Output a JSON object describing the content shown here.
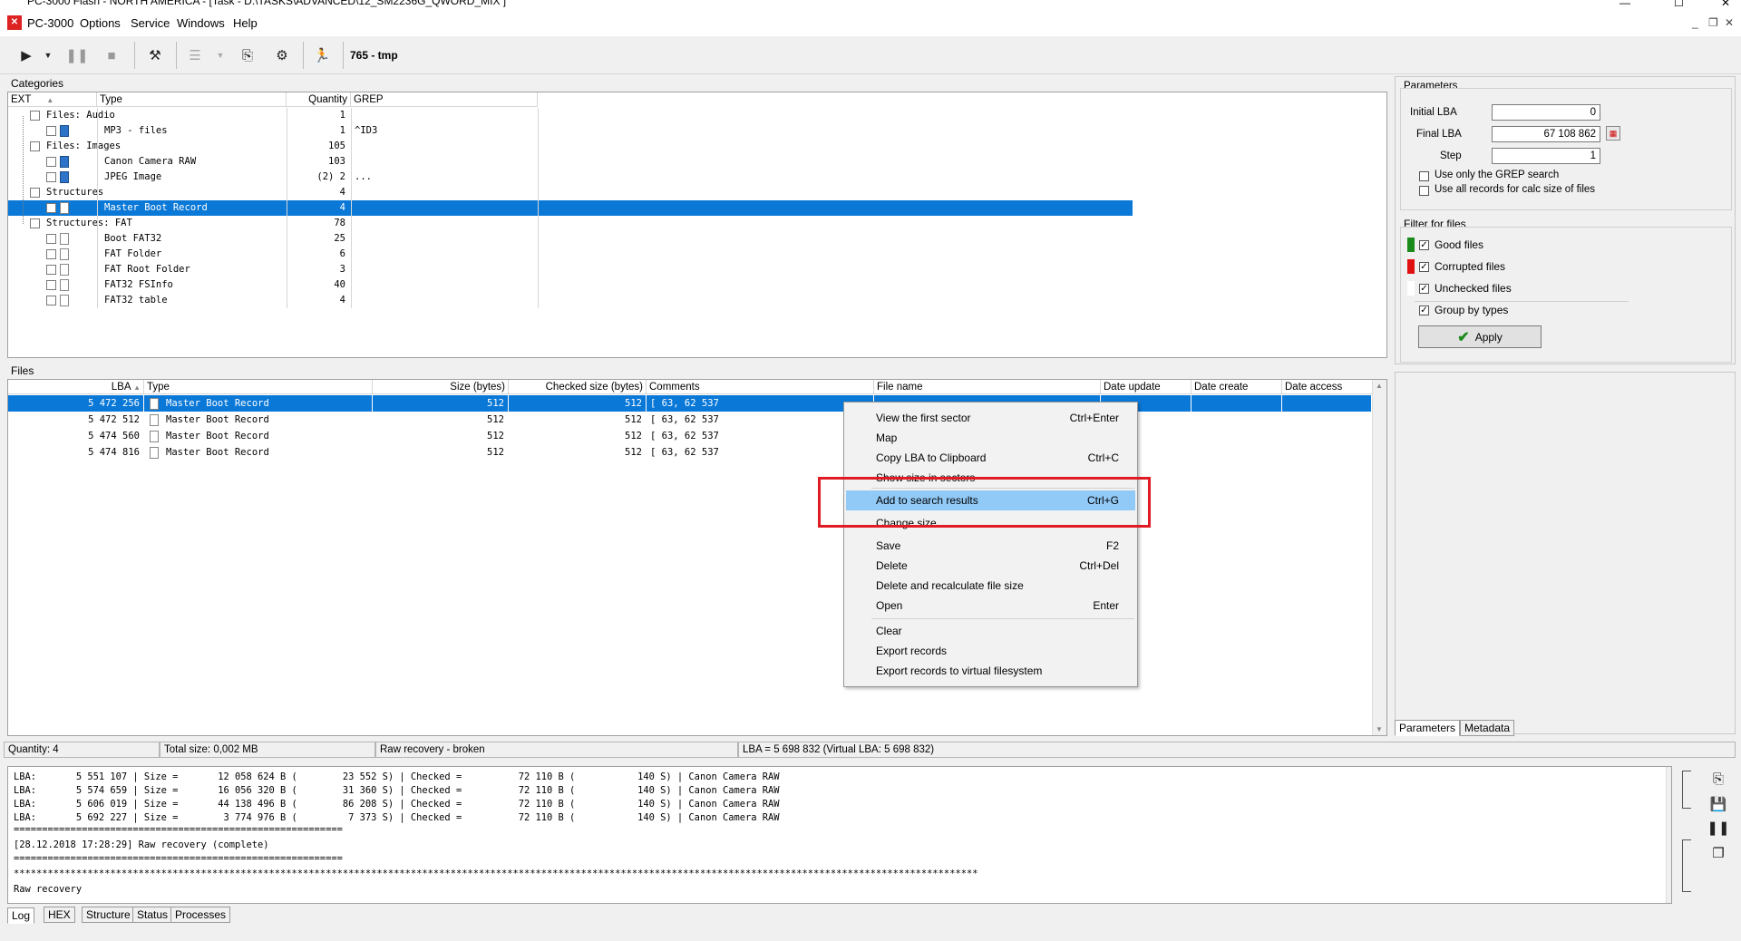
{
  "window": {
    "title": "PC-3000 Flash - NORTH AMERICA - [Task - D:\\TASKS\\ADVANCED\\12_SM2236G_QWORD_MIX ]"
  },
  "menubar": {
    "items": [
      "PC-3000",
      "Options",
      "Service",
      "Windows",
      "Help"
    ]
  },
  "toolbar": {
    "task_title": "765 - tmp"
  },
  "categories": {
    "label": "Categories",
    "columns": [
      "EXT",
      "Type",
      "Quantity",
      "GREP"
    ],
    "rows": [
      {
        "name": "Files: Audio",
        "quantity": "1",
        "grep": "",
        "level": 0
      },
      {
        "name": "MP3 - files",
        "quantity": "1",
        "grep": "^ID3",
        "level": 1
      },
      {
        "name": "Files: Images",
        "quantity": "105",
        "grep": "",
        "level": 0
      },
      {
        "name": "Canon Camera RAW",
        "quantity": "103",
        "grep": "",
        "level": 1
      },
      {
        "name": "JPEG Image",
        "quantity": "(2) 2",
        "grep": "...",
        "level": 1
      },
      {
        "name": "Structures",
        "quantity": "4",
        "grep": "",
        "level": 0
      },
      {
        "name": "Master Boot Record",
        "quantity": "4",
        "grep": "",
        "level": 1
      },
      {
        "name": "Structures: FAT",
        "quantity": "78",
        "grep": "",
        "level": 0
      },
      {
        "name": "Boot FAT32",
        "quantity": "25",
        "grep": "",
        "level": 1
      },
      {
        "name": "FAT Folder",
        "quantity": "6",
        "grep": "",
        "level": 1
      },
      {
        "name": "FAT Root Folder",
        "quantity": "3",
        "grep": "",
        "level": 1
      },
      {
        "name": "FAT32 FSInfo",
        "quantity": "40",
        "grep": "",
        "level": 1
      },
      {
        "name": "FAT32 table",
        "quantity": "4",
        "grep": "",
        "level": 1
      }
    ]
  },
  "files": {
    "label": "Files",
    "columns": [
      "LBA",
      "Type",
      "Size (bytes)",
      "Checked size (bytes)",
      "Comments",
      "File name",
      "Date update",
      "Date create",
      "Date access"
    ],
    "rows": [
      {
        "lba": "5 472 256",
        "type": "Master Boot Record",
        "size": "512",
        "checked": "512",
        "comments": "[          63,       62 537"
      },
      {
        "lba": "5 472 512",
        "type": "Master Boot Record",
        "size": "512",
        "checked": "512",
        "comments": "[          63,       62 537"
      },
      {
        "lba": "5 474 560",
        "type": "Master Boot Record",
        "size": "512",
        "checked": "512",
        "comments": "[          63,       62 537"
      },
      {
        "lba": "5 474 816",
        "type": "Master Boot Record",
        "size": "512",
        "checked": "512",
        "comments": "[          63,       62 537"
      }
    ]
  },
  "context_menu": {
    "items": [
      {
        "label": "View the first sector",
        "shortcut": "Ctrl+Enter"
      },
      {
        "label": "Map",
        "shortcut": ""
      },
      {
        "label": "Copy LBA to Clipboard",
        "shortcut": "Ctrl+C"
      },
      {
        "label": "Show size in sectors",
        "shortcut": ""
      },
      {
        "label": "Add to search results",
        "shortcut": "Ctrl+G"
      },
      {
        "label": "Change size",
        "shortcut": ""
      },
      {
        "label": "Save",
        "shortcut": "F2"
      },
      {
        "label": "Delete",
        "shortcut": "Ctrl+Del"
      },
      {
        "label": "Delete and recalculate file size",
        "shortcut": ""
      },
      {
        "label": "Open",
        "shortcut": "Enter"
      },
      {
        "label": "Clear",
        "shortcut": ""
      },
      {
        "label": "Export records",
        "shortcut": ""
      },
      {
        "label": "Export records to virtual filesystem",
        "shortcut": ""
      }
    ],
    "highlighted_index": 4
  },
  "parameters": {
    "label": "Parameters",
    "initial_lba_label": "Initial LBA",
    "initial_lba": "0",
    "final_lba_label": "Final  LBA",
    "final_lba": "67 108 862",
    "step_label": "Step",
    "step": "1",
    "grep_only_label": "Use only the GREP search",
    "grep_only_checked": false,
    "all_records_label": "Use all records for calc size of files",
    "all_records_checked": false
  },
  "filter": {
    "label": "Filter for files",
    "items": [
      {
        "label": "Good files",
        "checked": true,
        "color": "#1a8a1a"
      },
      {
        "label": "Corrupted files",
        "checked": true,
        "color": "#e01010"
      },
      {
        "label": "Unchecked files",
        "checked": true,
        "color": "#ffffff"
      }
    ],
    "group_by_types_label": "Group by types",
    "group_by_types_checked": true,
    "apply_label": "Apply"
  },
  "right_tabs": [
    "Parameters",
    "Metadata"
  ],
  "status": {
    "quantity": "Quantity: 4",
    "total_size": "Total size: 0,002 MB",
    "recovery": "Raw recovery - broken",
    "lba": "LBA = 5 698 832 (Virtual LBA: 5 698 832)"
  },
  "log": {
    "lines": [
      "LBA:       5 551 107 | Size =       12 058 624 B (        23 552 S) | Checked =          72 110 B (           140 S) | Canon Camera RAW",
      "LBA:       5 574 659 | Size =       16 056 320 B (        31 360 S) | Checked =          72 110 B (           140 S) | Canon Camera RAW",
      "LBA:       5 606 019 | Size =       44 138 496 B (        86 208 S) | Checked =          72 110 B (           140 S) | Canon Camera RAW",
      "LBA:       5 692 227 | Size =        3 774 976 B (         7 373 S) | Checked =          72 110 B (           140 S) | Canon Camera RAW",
      "==========================================================",
      "[28.12.2018 17:28:29] Raw recovery (complete)",
      "==========================================================",
      "**************************************************************************************************************************************************************************",
      "Raw recovery"
    ]
  },
  "bottom_tabs": [
    "Log",
    "HEX",
    "Structure",
    "Status",
    "Processes"
  ]
}
